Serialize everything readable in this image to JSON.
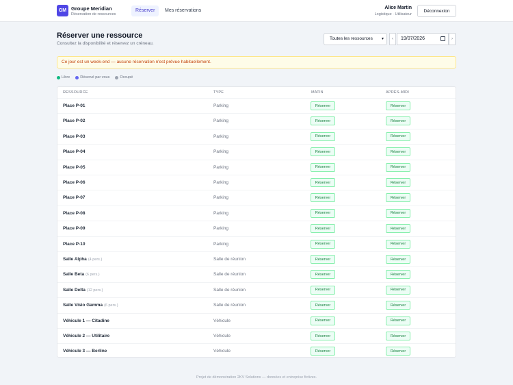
{
  "brand": {
    "logo": "GM",
    "name": "Groupe Meridian",
    "subtitle": "Réservation de ressources"
  },
  "nav": [
    {
      "label": "Réserver",
      "active": true
    },
    {
      "label": "Mes réservations",
      "active": false
    }
  ],
  "user": {
    "name": "Alice Martin",
    "role": "Logistique · Utilisateur",
    "logout_label": "Déconnexion"
  },
  "page": {
    "title": "Réserver une ressource",
    "subtitle": "Consultez la disponibilité et réservez un créneau."
  },
  "filter": {
    "selected": "Toutes les ressources"
  },
  "date": {
    "value": "19/07/2026",
    "prev": "‹",
    "next": "›"
  },
  "alert": {
    "text": "Ce jour est un week-end — aucune réservation n'est prévue habituellement.",
    "color": "#c2410c"
  },
  "legend": [
    {
      "label": "Libre",
      "color": "#10b981"
    },
    {
      "label": "Réservé par vous",
      "color": "#6366f1"
    },
    {
      "label": "Occupé",
      "color": "#9ca3af"
    }
  ],
  "table": {
    "headers": [
      "RESSOURCE",
      "TYPE",
      "MATIN",
      "APRÈS-MIDI"
    ],
    "button_label": "Réserver",
    "rows": [
      {
        "name": "Place P-01",
        "cap": "",
        "type": "Parking"
      },
      {
        "name": "Place P-02",
        "cap": "",
        "type": "Parking"
      },
      {
        "name": "Place P-03",
        "cap": "",
        "type": "Parking"
      },
      {
        "name": "Place P-04",
        "cap": "",
        "type": "Parking"
      },
      {
        "name": "Place P-05",
        "cap": "",
        "type": "Parking"
      },
      {
        "name": "Place P-06",
        "cap": "",
        "type": "Parking"
      },
      {
        "name": "Place P-07",
        "cap": "",
        "type": "Parking"
      },
      {
        "name": "Place P-08",
        "cap": "",
        "type": "Parking"
      },
      {
        "name": "Place P-09",
        "cap": "",
        "type": "Parking"
      },
      {
        "name": "Place P-10",
        "cap": "",
        "type": "Parking"
      },
      {
        "name": "Salle Alpha",
        "cap": "(4 pers.)",
        "type": "Salle de réunion"
      },
      {
        "name": "Salle Beta",
        "cap": "(6 pers.)",
        "type": "Salle de réunion"
      },
      {
        "name": "Salle Delta",
        "cap": "(12 pers.)",
        "type": "Salle de réunion"
      },
      {
        "name": "Salle Visio Gamma",
        "cap": "(6 pers.)",
        "type": "Salle de réunion"
      },
      {
        "name": "Véhicule 1 — Citadine",
        "cap": "",
        "type": "Véhicule"
      },
      {
        "name": "Véhicule 2 — Utilitaire",
        "cap": "",
        "type": "Véhicule"
      },
      {
        "name": "Véhicule 3 — Berline",
        "cap": "",
        "type": "Véhicule"
      }
    ]
  },
  "footer": "Projet de démonstration 2KV Solutions — données et entreprise fictives.",
  "colors": {
    "accent": "#4f46e5",
    "free": "#15803d"
  }
}
